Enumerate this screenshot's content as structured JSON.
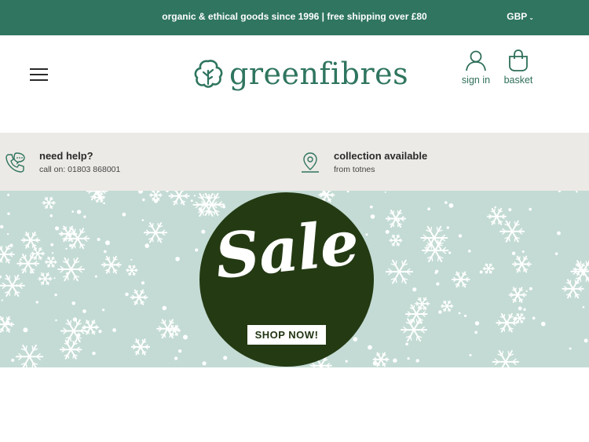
{
  "topbar": {
    "promo": "organic & ethical goods since 1996 | free shipping over £80",
    "currency": "GBP",
    "currency_chevron": "⌄"
  },
  "header": {
    "menu_icon": "hamburger-menu-icon",
    "logo_text": "greenfibres",
    "logo_icon": "leaf-tree-logo-icon",
    "sign_in_label": "sign in",
    "sign_in_icon": "user-icon",
    "basket_label": "basket",
    "basket_icon": "shopping-bag-icon"
  },
  "info": {
    "help": {
      "icon": "phone-chat-icon",
      "title": "need help?",
      "subtitle": "call on: 01803 868001"
    },
    "collection": {
      "icon": "map-pin-icon",
      "title": "collection available",
      "subtitle": "from totnes"
    }
  },
  "banner": {
    "headline": "Sale",
    "cta_label": "SHOP NOW!",
    "background_color": "#c3dbd4",
    "circle_color": "#243a13"
  },
  "colors": {
    "brand": "#2f7560",
    "topbar": "#2f7560",
    "infobar": "#eceae6"
  }
}
